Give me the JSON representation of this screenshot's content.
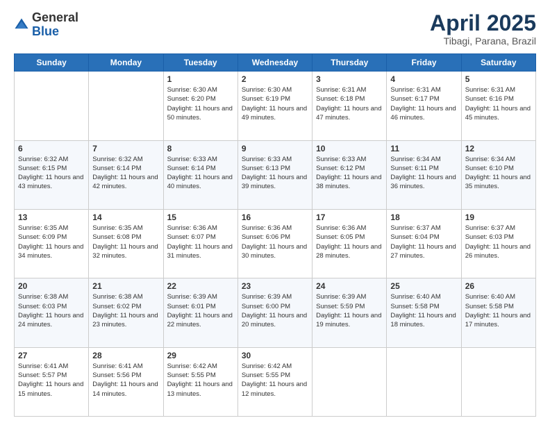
{
  "header": {
    "logo": {
      "general": "General",
      "blue": "Blue"
    },
    "title": "April 2025",
    "location": "Tibagi, Parana, Brazil"
  },
  "calendar": {
    "weekdays": [
      "Sunday",
      "Monday",
      "Tuesday",
      "Wednesday",
      "Thursday",
      "Friday",
      "Saturday"
    ],
    "weeks": [
      [
        {
          "day": "",
          "info": ""
        },
        {
          "day": "",
          "info": ""
        },
        {
          "day": "1",
          "info": "Sunrise: 6:30 AM\nSunset: 6:20 PM\nDaylight: 11 hours and 50 minutes."
        },
        {
          "day": "2",
          "info": "Sunrise: 6:30 AM\nSunset: 6:19 PM\nDaylight: 11 hours and 49 minutes."
        },
        {
          "day": "3",
          "info": "Sunrise: 6:31 AM\nSunset: 6:18 PM\nDaylight: 11 hours and 47 minutes."
        },
        {
          "day": "4",
          "info": "Sunrise: 6:31 AM\nSunset: 6:17 PM\nDaylight: 11 hours and 46 minutes."
        },
        {
          "day": "5",
          "info": "Sunrise: 6:31 AM\nSunset: 6:16 PM\nDaylight: 11 hours and 45 minutes."
        }
      ],
      [
        {
          "day": "6",
          "info": "Sunrise: 6:32 AM\nSunset: 6:15 PM\nDaylight: 11 hours and 43 minutes."
        },
        {
          "day": "7",
          "info": "Sunrise: 6:32 AM\nSunset: 6:14 PM\nDaylight: 11 hours and 42 minutes."
        },
        {
          "day": "8",
          "info": "Sunrise: 6:33 AM\nSunset: 6:14 PM\nDaylight: 11 hours and 40 minutes."
        },
        {
          "day": "9",
          "info": "Sunrise: 6:33 AM\nSunset: 6:13 PM\nDaylight: 11 hours and 39 minutes."
        },
        {
          "day": "10",
          "info": "Sunrise: 6:33 AM\nSunset: 6:12 PM\nDaylight: 11 hours and 38 minutes."
        },
        {
          "day": "11",
          "info": "Sunrise: 6:34 AM\nSunset: 6:11 PM\nDaylight: 11 hours and 36 minutes."
        },
        {
          "day": "12",
          "info": "Sunrise: 6:34 AM\nSunset: 6:10 PM\nDaylight: 11 hours and 35 minutes."
        }
      ],
      [
        {
          "day": "13",
          "info": "Sunrise: 6:35 AM\nSunset: 6:09 PM\nDaylight: 11 hours and 34 minutes."
        },
        {
          "day": "14",
          "info": "Sunrise: 6:35 AM\nSunset: 6:08 PM\nDaylight: 11 hours and 32 minutes."
        },
        {
          "day": "15",
          "info": "Sunrise: 6:36 AM\nSunset: 6:07 PM\nDaylight: 11 hours and 31 minutes."
        },
        {
          "day": "16",
          "info": "Sunrise: 6:36 AM\nSunset: 6:06 PM\nDaylight: 11 hours and 30 minutes."
        },
        {
          "day": "17",
          "info": "Sunrise: 6:36 AM\nSunset: 6:05 PM\nDaylight: 11 hours and 28 minutes."
        },
        {
          "day": "18",
          "info": "Sunrise: 6:37 AM\nSunset: 6:04 PM\nDaylight: 11 hours and 27 minutes."
        },
        {
          "day": "19",
          "info": "Sunrise: 6:37 AM\nSunset: 6:03 PM\nDaylight: 11 hours and 26 minutes."
        }
      ],
      [
        {
          "day": "20",
          "info": "Sunrise: 6:38 AM\nSunset: 6:03 PM\nDaylight: 11 hours and 24 minutes."
        },
        {
          "day": "21",
          "info": "Sunrise: 6:38 AM\nSunset: 6:02 PM\nDaylight: 11 hours and 23 minutes."
        },
        {
          "day": "22",
          "info": "Sunrise: 6:39 AM\nSunset: 6:01 PM\nDaylight: 11 hours and 22 minutes."
        },
        {
          "day": "23",
          "info": "Sunrise: 6:39 AM\nSunset: 6:00 PM\nDaylight: 11 hours and 20 minutes."
        },
        {
          "day": "24",
          "info": "Sunrise: 6:39 AM\nSunset: 5:59 PM\nDaylight: 11 hours and 19 minutes."
        },
        {
          "day": "25",
          "info": "Sunrise: 6:40 AM\nSunset: 5:58 PM\nDaylight: 11 hours and 18 minutes."
        },
        {
          "day": "26",
          "info": "Sunrise: 6:40 AM\nSunset: 5:58 PM\nDaylight: 11 hours and 17 minutes."
        }
      ],
      [
        {
          "day": "27",
          "info": "Sunrise: 6:41 AM\nSunset: 5:57 PM\nDaylight: 11 hours and 15 minutes."
        },
        {
          "day": "28",
          "info": "Sunrise: 6:41 AM\nSunset: 5:56 PM\nDaylight: 11 hours and 14 minutes."
        },
        {
          "day": "29",
          "info": "Sunrise: 6:42 AM\nSunset: 5:55 PM\nDaylight: 11 hours and 13 minutes."
        },
        {
          "day": "30",
          "info": "Sunrise: 6:42 AM\nSunset: 5:55 PM\nDaylight: 11 hours and 12 minutes."
        },
        {
          "day": "",
          "info": ""
        },
        {
          "day": "",
          "info": ""
        },
        {
          "day": "",
          "info": ""
        }
      ]
    ]
  }
}
